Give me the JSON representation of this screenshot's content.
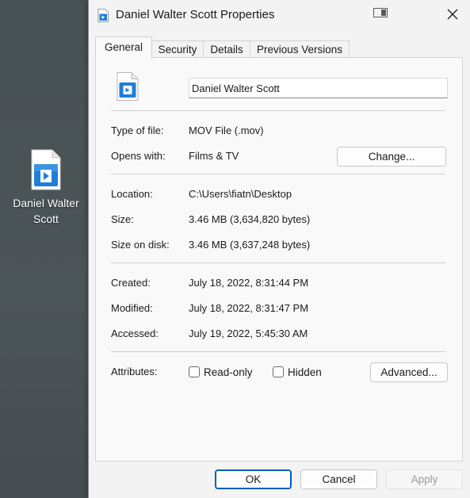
{
  "desktop": {
    "file_icon": "mov-file-icon",
    "label": "Daniel Walter Scott"
  },
  "window": {
    "title": "Daniel Walter Scott Properties",
    "tabs": [
      {
        "label": "General",
        "active": true
      },
      {
        "label": "Security",
        "active": false
      },
      {
        "label": "Details",
        "active": false
      },
      {
        "label": "Previous Versions",
        "active": false
      }
    ]
  },
  "general": {
    "file_name": "Daniel Walter Scott",
    "type_label": "Type of file:",
    "type_value": "MOV File (.mov)",
    "opens_label": "Opens with:",
    "opens_value": "Films & TV",
    "change_button": "Change...",
    "location_label": "Location:",
    "location_value": "C:\\Users\\fiatn\\Desktop",
    "size_label": "Size:",
    "size_value": "3.46 MB (3,634,820 bytes)",
    "size_disk_label": "Size on disk:",
    "size_disk_value": "3.46 MB (3,637,248 bytes)",
    "created_label": "Created:",
    "created_value": "July 18, 2022, 8:31:44 PM",
    "modified_label": "Modified:",
    "modified_value": "July 18, 2022, 8:31:47 PM",
    "accessed_label": "Accessed:",
    "accessed_value": "July 19, 2022, 5:45:30 AM",
    "attributes_label": "Attributes:",
    "readonly_label": "Read-only",
    "readonly_checked": false,
    "hidden_label": "Hidden",
    "hidden_checked": false,
    "advanced_button": "Advanced..."
  },
  "footer": {
    "ok": "OK",
    "cancel": "Cancel",
    "apply": "Apply"
  },
  "colors": {
    "accent": "#005fb8",
    "icon_blue": "#1f7fd6",
    "desktop": "#4a5356"
  }
}
